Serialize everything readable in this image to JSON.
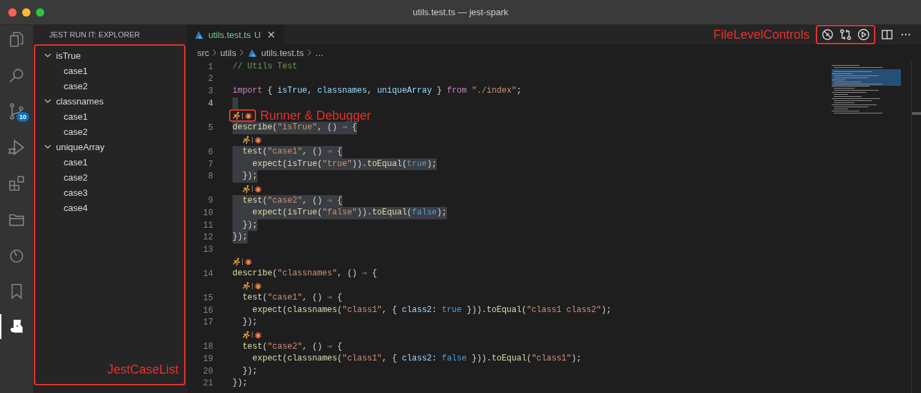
{
  "window": {
    "title": "utils.test.ts — jest-spark"
  },
  "activity_bar": [
    {
      "kind": "files",
      "selected": false
    },
    {
      "kind": "search",
      "selected": false
    },
    {
      "kind": "source-control",
      "selected": false,
      "badge": "10"
    },
    {
      "kind": "run-debug",
      "selected": false
    },
    {
      "kind": "extensions",
      "selected": false
    },
    {
      "kind": "folder",
      "selected": false
    },
    {
      "kind": "timer",
      "selected": false
    },
    {
      "kind": "bookmark",
      "selected": false
    },
    {
      "kind": "jest",
      "selected": true
    }
  ],
  "sidebar": {
    "title": "JEST RUN IT: EXPLORER",
    "annotation": "JestCaseList",
    "tree": [
      {
        "label": "isTrue",
        "expanded": true,
        "children": [
          {
            "label": "case1"
          },
          {
            "label": "case2"
          }
        ]
      },
      {
        "label": "classnames",
        "expanded": true,
        "children": [
          {
            "label": "case1"
          },
          {
            "label": "case2"
          }
        ]
      },
      {
        "label": "uniqueArray",
        "expanded": true,
        "children": [
          {
            "label": "case1"
          },
          {
            "label": "case2"
          },
          {
            "label": "case3"
          },
          {
            "label": "case4"
          }
        ]
      }
    ]
  },
  "editor": {
    "tabs": [
      {
        "label": "utils.test.ts",
        "status": "U",
        "selected": true
      }
    ],
    "breadcrumb": [
      {
        "kind": "folder",
        "text": "src"
      },
      {
        "kind": "folder",
        "text": "utils"
      },
      {
        "kind": "file",
        "text": "utils.test.ts"
      },
      {
        "kind": "more",
        "text": "…"
      }
    ],
    "file_controls_annotation": "FileLevelControls",
    "lines": [
      {
        "number": "1",
        "tokens": [
          {
            "kind": "comment",
            "text": "// Utils Test"
          }
        ]
      },
      {
        "number": "2"
      },
      {
        "number": "3",
        "tokens": [
          {
            "kind": "keyword",
            "text": "import"
          },
          {
            "kind": "plain",
            "text": " { "
          },
          {
            "kind": "variable",
            "text": "isTrue"
          },
          {
            "kind": "plain",
            "text": ", "
          },
          {
            "kind": "variable",
            "text": "classnames"
          },
          {
            "kind": "plain",
            "text": ", "
          },
          {
            "kind": "variable",
            "text": "uniqueArray"
          },
          {
            "kind": "plain",
            "text": " } "
          },
          {
            "kind": "keyword",
            "text": "from "
          },
          {
            "kind": "string",
            "text": "\"./index\""
          },
          {
            "kind": "plain",
            "text": ";"
          }
        ]
      },
      {
        "number": "4",
        "current": true
      },
      {
        "number": "5",
        "lens": true,
        "lens_annotation": "Runner & Debugger",
        "highlighted": true,
        "tokens": [
          {
            "kind": "function",
            "text": "describe"
          },
          {
            "kind": "plain",
            "text": "("
          },
          {
            "kind": "string",
            "text": "\"isTrue\""
          },
          {
            "kind": "plain",
            "text": ", () "
          },
          {
            "kind": "operator",
            "text": "⇒"
          },
          {
            "kind": "plain",
            "text": " {"
          }
        ]
      },
      {
        "number": "6",
        "lens": true,
        "highlighted": true,
        "tokens": [
          {
            "kind": "function",
            "text": "  test"
          },
          {
            "kind": "plain",
            "text": "("
          },
          {
            "kind": "string",
            "text": "\"case1\""
          },
          {
            "kind": "plain",
            "text": ", () "
          },
          {
            "kind": "operator",
            "text": "⇒"
          },
          {
            "kind": "plain",
            "text": " {"
          }
        ]
      },
      {
        "number": "7",
        "highlighted": true,
        "tokens": [
          {
            "kind": "function",
            "text": "    expect"
          },
          {
            "kind": "plain",
            "text": "("
          },
          {
            "kind": "function",
            "text": "isTrue"
          },
          {
            "kind": "plain",
            "text": "("
          },
          {
            "kind": "string",
            "text": "\"true\""
          },
          {
            "kind": "plain",
            "text": "))."
          },
          {
            "kind": "function",
            "text": "toEqual"
          },
          {
            "kind": "plain",
            "text": "("
          },
          {
            "kind": "constant",
            "text": "true"
          },
          {
            "kind": "plain",
            "text": ");"
          }
        ]
      },
      {
        "number": "8",
        "highlighted": true,
        "tokens": [
          {
            "kind": "plain",
            "text": "  });"
          }
        ]
      },
      {
        "number": "9",
        "lens": true,
        "highlighted": true,
        "tokens": [
          {
            "kind": "function",
            "text": "  test"
          },
          {
            "kind": "plain",
            "text": "("
          },
          {
            "kind": "string",
            "text": "\"case2\""
          },
          {
            "kind": "plain",
            "text": ", () "
          },
          {
            "kind": "operator",
            "text": "⇒"
          },
          {
            "kind": "plain",
            "text": " {"
          }
        ]
      },
      {
        "number": "10",
        "highlighted": true,
        "tokens": [
          {
            "kind": "function",
            "text": "    expect"
          },
          {
            "kind": "plain",
            "text": "("
          },
          {
            "kind": "function",
            "text": "isTrue"
          },
          {
            "kind": "plain",
            "text": "("
          },
          {
            "kind": "string",
            "text": "\"false\""
          },
          {
            "kind": "plain",
            "text": "))."
          },
          {
            "kind": "function",
            "text": "toEqual"
          },
          {
            "kind": "plain",
            "text": "("
          },
          {
            "kind": "constant",
            "text": "false"
          },
          {
            "kind": "plain",
            "text": ");"
          }
        ]
      },
      {
        "number": "11",
        "highlighted": true,
        "tokens": [
          {
            "kind": "plain",
            "text": "  });"
          }
        ]
      },
      {
        "number": "12",
        "highlighted": true,
        "tokens": [
          {
            "kind": "plain",
            "text": "});"
          }
        ]
      },
      {
        "number": "13"
      },
      {
        "number": "14",
        "lens": true,
        "highlighted": false,
        "tokens": [
          {
            "kind": "function",
            "text": "describe"
          },
          {
            "kind": "plain",
            "text": "("
          },
          {
            "kind": "string",
            "text": "\"classnames\""
          },
          {
            "kind": "plain",
            "text": ", () "
          },
          {
            "kind": "operator",
            "text": "⇒"
          },
          {
            "kind": "plain",
            "text": " {"
          }
        ]
      },
      {
        "number": "15",
        "lens": true,
        "highlighted": false,
        "tokens": [
          {
            "kind": "function",
            "text": "  test"
          },
          {
            "kind": "plain",
            "text": "("
          },
          {
            "kind": "string",
            "text": "\"case1\""
          },
          {
            "kind": "plain",
            "text": ", () "
          },
          {
            "kind": "operator",
            "text": "⇒"
          },
          {
            "kind": "plain",
            "text": " {"
          }
        ]
      },
      {
        "number": "16",
        "highlighted": false,
        "tokens": [
          {
            "kind": "function",
            "text": "    expect"
          },
          {
            "kind": "plain",
            "text": "("
          },
          {
            "kind": "function",
            "text": "classnames"
          },
          {
            "kind": "plain",
            "text": "("
          },
          {
            "kind": "string",
            "text": "\"class1\""
          },
          {
            "kind": "plain",
            "text": ", { "
          },
          {
            "kind": "variable",
            "text": "class2: "
          },
          {
            "kind": "constant",
            "text": "true"
          },
          {
            "kind": "plain",
            "text": " }))."
          },
          {
            "kind": "function",
            "text": "toEqual"
          },
          {
            "kind": "plain",
            "text": "("
          },
          {
            "kind": "string",
            "text": "\"class1 class2\""
          },
          {
            "kind": "plain",
            "text": ");"
          }
        ]
      },
      {
        "number": "17",
        "highlighted": false,
        "tokens": [
          {
            "kind": "plain",
            "text": "  });"
          }
        ]
      },
      {
        "number": "18",
        "lens": true,
        "highlighted": false,
        "tokens": [
          {
            "kind": "function",
            "text": "  test"
          },
          {
            "kind": "plain",
            "text": "("
          },
          {
            "kind": "string",
            "text": "\"case2\""
          },
          {
            "kind": "plain",
            "text": ", () "
          },
          {
            "kind": "operator",
            "text": "⇒"
          },
          {
            "kind": "plain",
            "text": " {"
          }
        ]
      },
      {
        "number": "19",
        "highlighted": false,
        "tokens": [
          {
            "kind": "function",
            "text": "    expect"
          },
          {
            "kind": "plain",
            "text": "("
          },
          {
            "kind": "function",
            "text": "classnames"
          },
          {
            "kind": "plain",
            "text": "("
          },
          {
            "kind": "string",
            "text": "\"class1\""
          },
          {
            "kind": "plain",
            "text": ", { "
          },
          {
            "kind": "variable",
            "text": "class2: "
          },
          {
            "kind": "constant",
            "text": "false"
          },
          {
            "kind": "plain",
            "text": " }))."
          },
          {
            "kind": "function",
            "text": "toEqual"
          },
          {
            "kind": "plain",
            "text": "("
          },
          {
            "kind": "string",
            "text": "\"class1\""
          },
          {
            "kind": "plain",
            "text": ");"
          }
        ]
      },
      {
        "number": "20",
        "highlighted": false,
        "tokens": [
          {
            "kind": "plain",
            "text": "  });"
          }
        ]
      },
      {
        "number": "21",
        "highlighted": false,
        "tokens": [
          {
            "kind": "plain",
            "text": "});"
          }
        ]
      }
    ]
  }
}
